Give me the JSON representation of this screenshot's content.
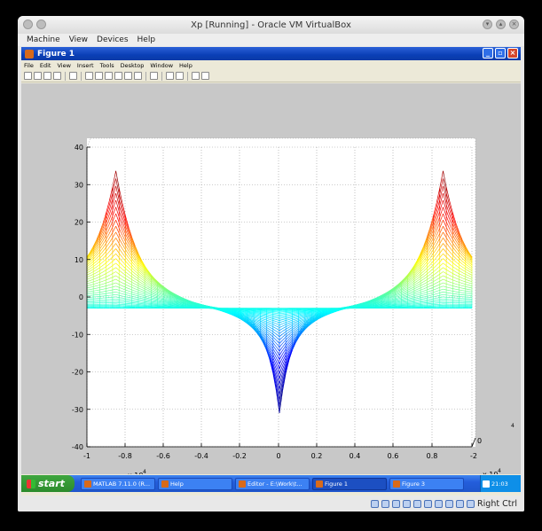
{
  "vbox": {
    "title": "Xp [Running] - Oracle VM VirtualBox",
    "menu": [
      "Machine",
      "View",
      "Devices",
      "Help"
    ],
    "status_host_key": "Right Ctrl"
  },
  "figure": {
    "title": "Figure 1",
    "menu": [
      "File",
      "Edit",
      "View",
      "Insert",
      "Tools",
      "Desktop",
      "Window",
      "Help"
    ]
  },
  "taskbar": {
    "start_label": "start",
    "items": [
      {
        "label": "MATLAB  7.11.0 (R..."
      },
      {
        "label": "Help"
      },
      {
        "label": "Editor - E:\\Work\\t..."
      },
      {
        "label": "Figure 1"
      },
      {
        "label": "Figure 3"
      }
    ],
    "clock": "21:03"
  },
  "chart_data": {
    "type": "surface-mesh",
    "xlim": [
      -1,
      -2
    ],
    "x_ticks": [
      "-1",
      "-0.8",
      "-0.6",
      "-0.4",
      "-0.2",
      "0",
      "0.2",
      "0.4",
      "0.6",
      "0.8",
      "1",
      "-2"
    ],
    "x_exponent_left": "x 10",
    "x_exponent_left_pow": "4",
    "x_exponent_right": "x 10",
    "x_exponent_right_pow": "4",
    "ylim": [
      -40,
      40
    ],
    "y_ticks": [
      "40",
      "30",
      "20",
      "10",
      "0",
      "-10",
      "-20",
      "-30",
      "-40"
    ],
    "depth_ticks": [
      "0"
    ],
    "grid": true,
    "colormap": [
      "#00008f",
      "#0000ff",
      "#00ffff",
      "#ffff00",
      "#ff0000",
      "#800000"
    ]
  }
}
